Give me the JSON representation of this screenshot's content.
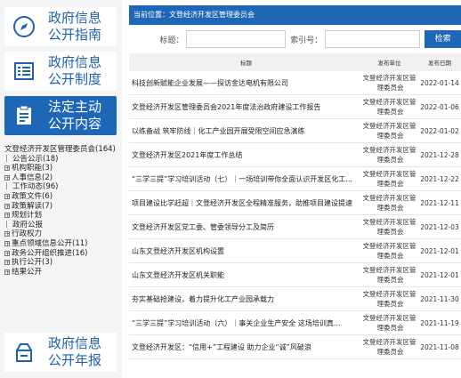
{
  "nav": [
    {
      "icon": "compass-icon",
      "label_l1": "政府信息",
      "label_l2": "公开指南"
    },
    {
      "icon": "list-document-icon",
      "label_l1": "政府信息",
      "label_l2": "公开制度"
    },
    {
      "icon": "clipboard-icon",
      "label_l1": "法定主动",
      "label_l2": "公开内容",
      "active": true
    },
    {
      "icon": "open-box-icon",
      "label_l1": "政府信息",
      "label_l2": "公开年报"
    }
  ],
  "tree": {
    "root": "文登经济开发区管理委员会(164)",
    "items": [
      {
        "label": "公告公示(18)",
        "type": "leaf"
      },
      {
        "label": "机构职能(3)",
        "type": "expand"
      },
      {
        "label": "人事信息(2)",
        "type": "expand"
      },
      {
        "label": "工作动态(96)",
        "type": "leaf"
      },
      {
        "label": "政策文件(6)",
        "type": "expand"
      },
      {
        "label": "政策解读(7)",
        "type": "expand"
      },
      {
        "label": "规划计划",
        "type": "expand"
      },
      {
        "label": "政府公报",
        "type": "leaf"
      },
      {
        "label": "行政权力",
        "type": "expand"
      },
      {
        "label": "重点领域信息公开(11)",
        "type": "expand"
      },
      {
        "label": "政务公开组织推进(16)",
        "type": "expand"
      },
      {
        "label": "执行公开(3)",
        "type": "expand"
      },
      {
        "label": "结果公开",
        "type": "expand"
      }
    ]
  },
  "breadcrumb": "当前位置：文登经济开发区管理委员会",
  "search": {
    "title_label": "标题：",
    "index_label": "索引号：",
    "button": "检索"
  },
  "table": {
    "headers": {
      "title": "标题",
      "unit": "发布单位",
      "date": "发布日期"
    },
    "rows": [
      {
        "title": "科技创新赋能企业发展——探访金达电机有限公司",
        "unit_l1": "文登经济开发区管",
        "unit_l2": "理委员会",
        "date": "2022-01-14"
      },
      {
        "title": "文登经济开发区管理委员会2021年度法治政府建设工作报告",
        "unit_l1": "文登经济开发区管",
        "unit_l2": "理委员会",
        "date": "2022-01-06"
      },
      {
        "title": "以练备战 筑牢防线｜化工产业园开展受限空间应急演练",
        "unit_l1": "文登经济开发区管",
        "unit_l2": "理委员会",
        "date": "2022-01-02"
      },
      {
        "title": "文登经济开发区2021年度工作总结",
        "unit_l1": "文登经济开发区管",
        "unit_l2": "理委员会",
        "date": "2021-12-28"
      },
      {
        "title": "“三学三提”学习培训活动（七）｜一场培训带你全面认识开发区化工...",
        "unit_l1": "文登经济开发区管",
        "unit_l2": "理委员会",
        "date": "2021-12-22"
      },
      {
        "title": "项目建设比学赶超｜文登经济开发区全程精准服务，助推项目建设提速",
        "unit_l1": "文登经济开发区管",
        "unit_l2": "理委员会",
        "date": "2021-12-11"
      },
      {
        "title": "文登经济开发区党工委、管委领导分工及简历",
        "unit_l1": "文登经济开发区管",
        "unit_l2": "理委员会",
        "date": "2021-12-03"
      },
      {
        "title": "山东文登经济开发区机构设置",
        "unit_l1": "文登经济开发区管",
        "unit_l2": "理委员会",
        "date": "2021-12-01"
      },
      {
        "title": "山东文登经济开发区机关职能",
        "unit_l1": "文登经济开发区管",
        "unit_l2": "理委员会",
        "date": "2021-12-01"
      },
      {
        "title": "夯实基础抢建设，着力提升化工产业园承载力",
        "unit_l1": "文登经济开发区管",
        "unit_l2": "理委员会",
        "date": "2021-11-30"
      },
      {
        "title": "“三学三提”学习培训活动（六）｜事关企业生产安全 这场培训真...",
        "unit_l1": "文登经济开发区管",
        "unit_l2": "理委员会",
        "date": "2021-11-19"
      },
      {
        "title": "文登经济开发区：“信用+”工程建设 助力企业“诚”风破浪",
        "unit_l1": "文登经济开发区管",
        "unit_l2": "理委员会",
        "date": "2021-11-08"
      }
    ]
  }
}
